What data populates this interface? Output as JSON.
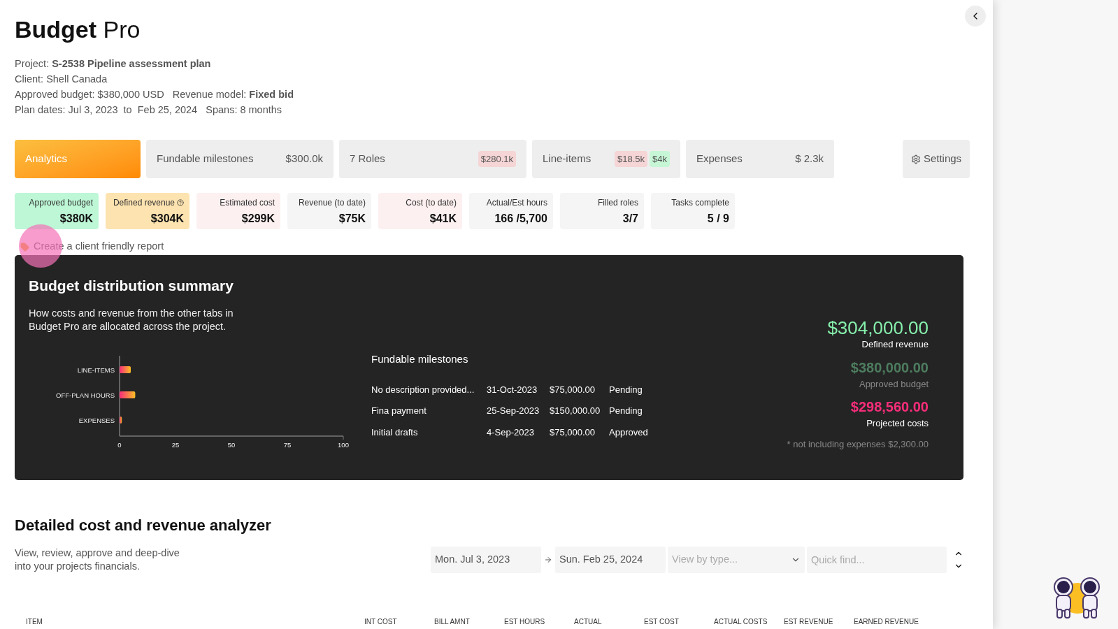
{
  "app": {
    "title_bold": "Budget",
    "title_light": "Pro"
  },
  "project_info": [
    "Project: **S-2538 Pipeline assessment plan**",
    "Client: Shell Canada",
    "Approved budget: $380,000 USD   Revenue model: **Fixed bid**",
    "Plan dates: Jul 3, 2023  to  Feb 25, 2024   Spans: 8 months"
  ],
  "tabs": [
    {
      "label": "Analytics",
      "selected": true
    },
    {
      "label": "Fundable milestones",
      "value": "$300.0k",
      "selected": false
    },
    {
      "label": "7 Roles",
      "selected": false,
      "badges": [
        {
          "text": "$280.1k",
          "color": "#f5d5d5"
        }
      ]
    },
    {
      "label": "Line-items",
      "selected": false,
      "badges": [
        {
          "text": "$18.5k",
          "color": "#f5d5d5"
        },
        {
          "text": "$4k",
          "color": "#c6f6d5"
        }
      ]
    },
    {
      "label": "Expenses",
      "value": "$ 2.3k",
      "selected": false
    }
  ],
  "settings_button": "Settings",
  "stats": [
    {
      "label": "Approved budget",
      "value": "$380K",
      "color": "#bdf7d6",
      "help": false
    },
    {
      "label": "Defined revenue",
      "value": "$304K",
      "color": "#fde3b0",
      "help": true
    },
    {
      "label": "Estimated cost",
      "value": "$299K",
      "color": "#fdf0f0",
      "help": false
    },
    {
      "label": "Revenue (to date)",
      "value": "$75K",
      "color": "#f5f5f5",
      "help": false
    },
    {
      "label": "Cost (to date)",
      "value": "$41K",
      "color": "#fdf0f0",
      "help": false
    },
    {
      "label": "Actual/Est hours",
      "value": "166 /5,700",
      "color": "#f5f5f5",
      "help": false
    },
    {
      "label": "Filled roles",
      "value": "3/7",
      "color": "#f5f5f5",
      "help": false
    },
    {
      "label": "Tasks complete",
      "value": "5 / 9",
      "color": "#f5f5f5",
      "help": false
    }
  ],
  "report_link": "Create a client friendly report",
  "summary": {
    "title": "Budget distribution summary",
    "description": "How costs and revenue from the other tabs in Budget Pro are allocated across the project.",
    "chart_data": {
      "type": "bar",
      "orientation": "horizontal",
      "categories": [
        "LINE-ITEMS",
        "OFF-PLAN HOURS",
        "EXPENSES"
      ],
      "values": [
        5,
        7,
        1
      ],
      "xlim": [
        0,
        100
      ],
      "xticks": [
        0,
        25,
        50,
        75,
        100
      ]
    },
    "milestones_title": "Fundable milestones",
    "milestones": [
      {
        "description": "No description provided...",
        "date": "31-Oct-2023",
        "amount": "$75,000.00",
        "status": "Pending"
      },
      {
        "description": "Fina payment",
        "date": "25-Sep-2023",
        "amount": "$150,000.00",
        "status": "Pending"
      },
      {
        "description": "Initial drafts",
        "date": "4-Sep-2023",
        "amount": "$75,000.00",
        "status": "Approved"
      }
    ],
    "totals": [
      {
        "amount": "$304,000.00",
        "label": "Defined revenue",
        "color": "#86efac"
      },
      {
        "amount": "$380,000.00",
        "label": "Approved budget",
        "color": "#4d7c5f"
      },
      {
        "amount": "$298,560.00",
        "label": "Projected costs",
        "color": "#f72d7a"
      }
    ],
    "note": "* not including expenses $2,300.00"
  },
  "analyzer": {
    "title": "Detailed cost and revenue analyzer",
    "description": "View, review, approve and deep-dive into your projects financials.",
    "date_from": "Mon. Jul 3, 2023",
    "date_to": "Sun. Feb 25, 2024",
    "type_placeholder": "View by type...",
    "search_placeholder": "Quick find...",
    "columns": [
      "ITEM",
      "INT COST",
      "BILL AMNT",
      "EST HOURS",
      "ACTUAL",
      "EST COST",
      "ACTUAL COSTS",
      "EST REVENUE",
      "EARNED REVENUE"
    ]
  }
}
